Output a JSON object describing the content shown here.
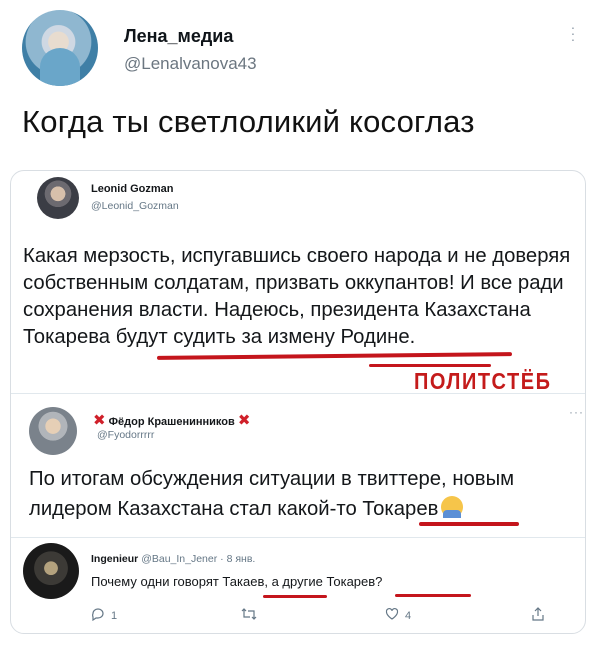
{
  "tweet": {
    "author_name": "Лена_медиа",
    "author_handle": "@Lenalvanova43",
    "more_icon": "more-vertical-icon",
    "text": "Когда ты светлоликий косоглаз"
  },
  "card": {
    "tweet1": {
      "name": "Leonid Gozman",
      "handle": "@Leonid_Gozman",
      "text": "Какая мерзость, испугавшись своего народа и не доверяя собственным солдатам, призвать оккупантов! И все ради сохранения власти. Надеюсь, президента Казахстана Токарева будут судить за измену Родине."
    },
    "watermark": "ПОЛИТСТЁБ",
    "tweet2": {
      "x_left": "✖",
      "name": "Фёдор Крашенинников",
      "x_right": "✖",
      "handle": "@Fyodorrrrr",
      "more": "···",
      "text": "По итогам обсуждения ситуации в твиттере, новым лидером Казахстана стал какой-то Токарев"
    },
    "tweet3": {
      "name": "Ingenieur",
      "handle": "@Bau_In_Jener",
      "dot": "·",
      "date": "8 янв.",
      "text": "Почему одни говорят Такаев, а другие Токарев?",
      "reply_count": "1",
      "retweet_count": "",
      "like_count": "4",
      "icons": {
        "reply": "reply-icon",
        "retweet": "retweet-icon",
        "like": "heart-icon",
        "share": "share-icon"
      }
    }
  },
  "colors": {
    "accent_red": "#c4151c",
    "muted": "#657786"
  }
}
